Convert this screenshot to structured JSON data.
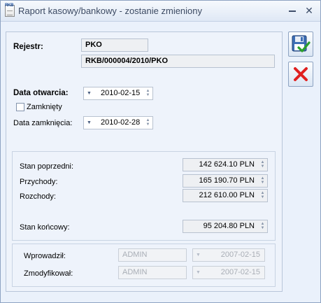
{
  "window": {
    "title": "Raport kasowy/bankowy - zostanie zmieniony",
    "icon_tag": "RKB"
  },
  "form": {
    "rejestr_label": "Rejestr:",
    "rejestr_value": "PKO",
    "numer_value": "RKB/000004/2010/PKO",
    "data_otwarcia_label": "Data otwarcia:",
    "data_otwarcia_value": "2010-02-15",
    "zamkniety_label": "Zamknięty",
    "zamkniety_checked": false,
    "data_zamkniecia_label": "Data zamknięcia:",
    "data_zamkniecia_value": "2010-02-28"
  },
  "balances": {
    "stan_poprzedni_label": "Stan poprzedni:",
    "stan_poprzedni_value": "142 624.10 PLN",
    "przychody_label": "Przychody:",
    "przychody_value": "165 190.70 PLN",
    "rozchody_label": "Rozchody:",
    "rozchody_value": "212 610.00 PLN",
    "stan_koncowy_label": "Stan końcowy:",
    "stan_koncowy_value": "95 204.80 PLN"
  },
  "audit": {
    "wprowadzil_label": "Wprowadził:",
    "wprowadzil_user": "ADMIN",
    "wprowadzil_date": "2007-02-15",
    "zmodyfikowal_label": "Zmodyfikował:",
    "zmodyfikowal_user": "ADMIN",
    "zmodyfikowal_date": "2007-02-15"
  },
  "buttons": [
    {
      "name": "save-button",
      "icon": "floppy-disk-check-icon"
    },
    {
      "name": "cancel-button",
      "icon": "red-x-icon"
    }
  ],
  "colors": {
    "accent": "#1c4e9c",
    "cancel": "#e02020",
    "confirm": "#2aa02a"
  }
}
